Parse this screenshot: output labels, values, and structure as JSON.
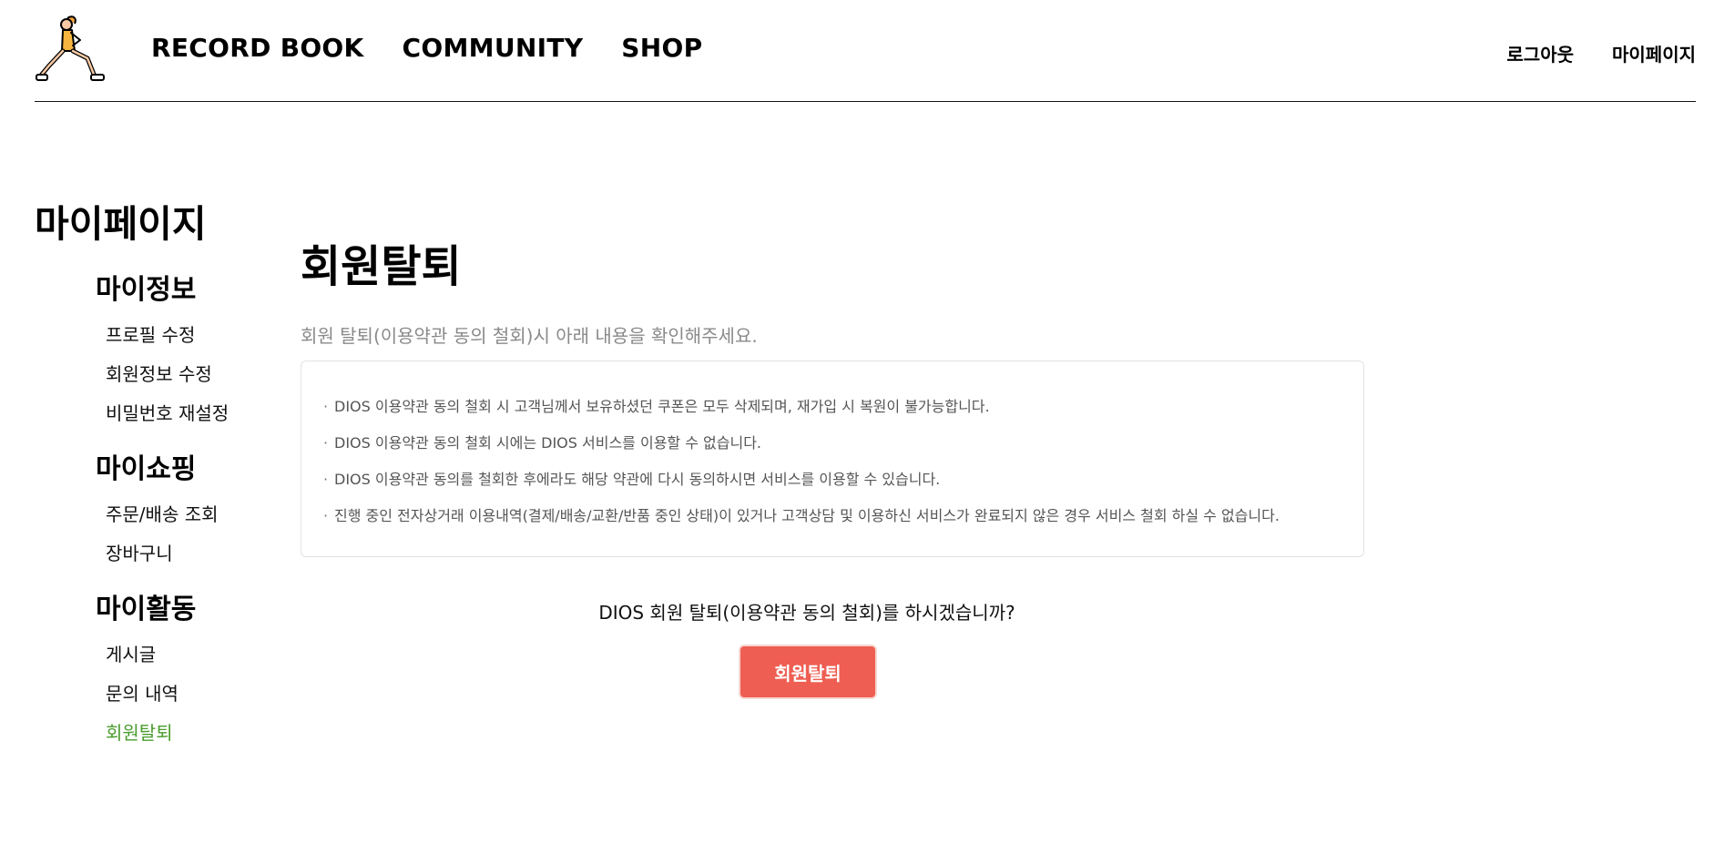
{
  "header": {
    "nav": [
      "RECORD BOOK",
      "COMMUNITY",
      "SHOP"
    ],
    "logout_label": "로그아웃",
    "mypage_label": "마이페이지",
    "logo_icon": "lunging-runner-icon"
  },
  "sidebar": {
    "title": "마이페이지",
    "sections": [
      {
        "heading": "마이정보",
        "items": [
          "프로필 수정",
          "회원정보 수정",
          "비밀번호 재설정"
        ]
      },
      {
        "heading": "마이쇼핑",
        "items": [
          "주문/배송 조회",
          "장바구니"
        ]
      },
      {
        "heading": "마이활동",
        "items": [
          "게시글",
          "문의 내역",
          "회원탈퇴"
        ]
      }
    ],
    "active_item": "회원탈퇴"
  },
  "main": {
    "title": "회원탈퇴",
    "subtitle": "회원 탈퇴(이용약관 동의 철회)시 아래 내용을 확인해주세요.",
    "notices": [
      "DIOS 이용약관 동의 철회 시 고객님께서 보유하셨던 쿠폰은 모두 삭제되며, 재가입 시 복원이 불가능합니다.",
      "DIOS 이용약관 동의 철회 시에는 DIOS 서비스를 이용할 수 없습니다.",
      "DIOS 이용약관 동의를 철회한 후에라도 해당 약관에 다시 동의하시면 서비스를 이용할 수 있습니다.",
      "진행 중인 전자상거래 이용내역(결제/배송/교환/반품 중인 상태)이 있거나 고객상담 및 이용하신 서비스가 완료되지 않은 경우 서비스 철회 하실 수 없습니다."
    ],
    "confirm_text": "DIOS 회원 탈퇴(이용약관 동의 철회)를 하시겠습니까?",
    "button_label": "회원탈퇴"
  },
  "colors": {
    "active_menu": "#4a9c2d",
    "button_bg": "#ee5e52",
    "subtitle": "#8a8a8a"
  }
}
